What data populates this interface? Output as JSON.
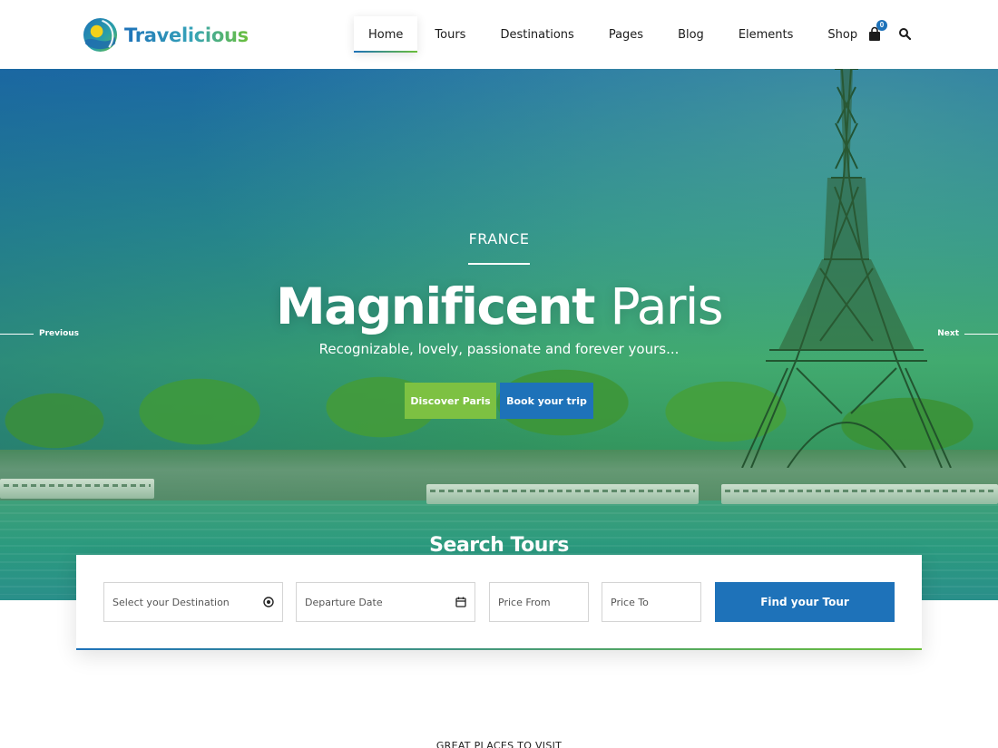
{
  "brand": {
    "name": "Travelicious",
    "logo_icon": "globe-sun-icon",
    "colors": {
      "primary": "#1e72b9",
      "accent": "#7dc142"
    }
  },
  "nav": {
    "items": [
      {
        "label": "Home",
        "active": true
      },
      {
        "label": "Tours",
        "active": false
      },
      {
        "label": "Destinations",
        "active": false
      },
      {
        "label": "Pages",
        "active": false
      },
      {
        "label": "Blog",
        "active": false
      },
      {
        "label": "Elements",
        "active": false
      },
      {
        "label": "Shop",
        "active": false
      }
    ],
    "cart_icon": "shopping-bag-icon",
    "cart_count": "0",
    "search_icon": "search-icon"
  },
  "hero": {
    "eyebrow": "FRANCE",
    "title_strong": "Magnificent",
    "title_light": "Paris",
    "subtitle": "Recognizable, lovely, passionate and forever yours...",
    "primary_button": "Discover Paris",
    "secondary_button": "Book your trip",
    "prev_label": "Previous",
    "next_label": "Next"
  },
  "search": {
    "heading": "Search Tours",
    "destination_placeholder": "Select your Destination",
    "destination_icon": "target-icon",
    "date_placeholder": "Departure Date",
    "date_icon": "calendar-icon",
    "price_from_placeholder": "Price From",
    "price_to_placeholder": "Price To",
    "submit_label": "Find your Tour"
  },
  "next_section": {
    "eyebrow": "GREAT PLACES TO VISIT"
  }
}
